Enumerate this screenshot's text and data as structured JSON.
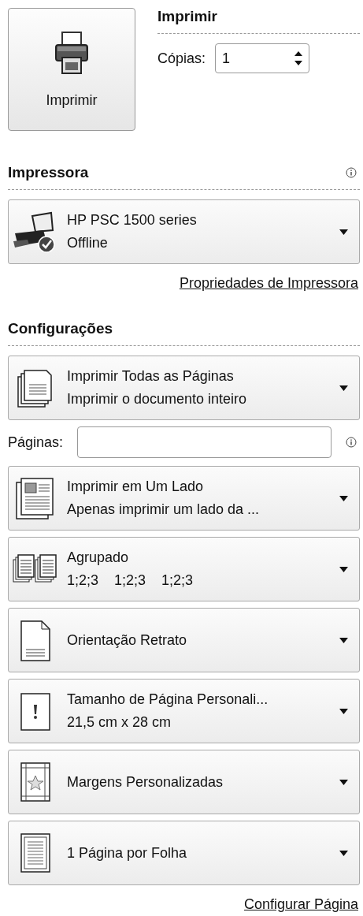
{
  "print_button": {
    "label": "Imprimir"
  },
  "print_section": {
    "title": "Imprimir",
    "copies_label": "Cópias:",
    "copies_value": "1"
  },
  "printer_section": {
    "title": "Impressora",
    "printer": {
      "name": "HP PSC 1500 series",
      "status": "Offline"
    },
    "link": "Propriedades de Impressora"
  },
  "settings_section": {
    "title": "Configurações",
    "items": [
      {
        "kind": "pages",
        "title": "Imprimir Todas as Páginas",
        "subtitle": "Imprimir o documento inteiro"
      },
      {
        "kind": "pages_field",
        "label": "Páginas:"
      },
      {
        "kind": "sides",
        "title": "Imprimir em Um Lado",
        "subtitle": "Apenas imprimir um lado da ..."
      },
      {
        "kind": "collate",
        "title": "Agrupado",
        "subtitle": "1;2;3    1;2;3    1;2;3"
      },
      {
        "kind": "orientation",
        "title": "Orientação Retrato"
      },
      {
        "kind": "size",
        "title": "Tamanho de Página Personali...",
        "subtitle": "21,5 cm x 28 cm"
      },
      {
        "kind": "margins",
        "title": "Margens Personalizadas"
      },
      {
        "kind": "per_sheet",
        "title": "1 Página por Folha"
      }
    ],
    "link": "Configurar Página"
  }
}
